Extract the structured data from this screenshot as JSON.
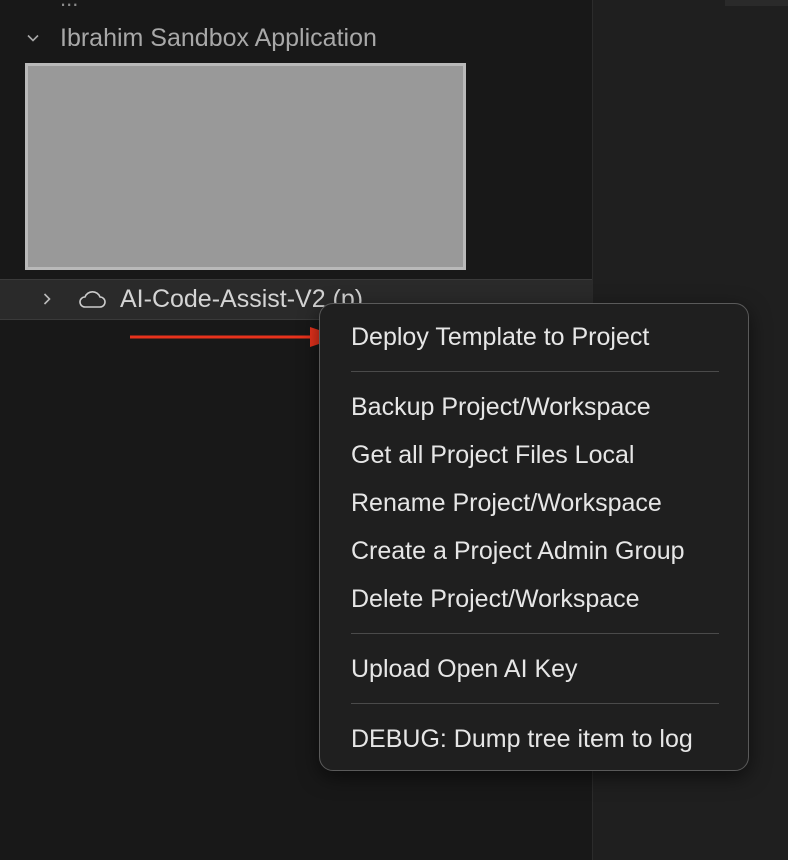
{
  "explorer": {
    "cut_off_text": "...",
    "group": {
      "label": "Ibrahim Sandbox Application",
      "expanded": true
    },
    "project_item": {
      "label": "AI-Code-Assist-V2 (p)",
      "icon": "cloud-icon",
      "expanded": false
    }
  },
  "context_menu": {
    "items": [
      "Deploy Template to Project",
      "Backup Project/Workspace",
      "Get all Project Files Local",
      "Rename Project/Workspace",
      "Create a Project Admin Group",
      "Delete Project/Workspace",
      "Upload Open AI Key",
      "DEBUG: Dump tree item to log"
    ]
  },
  "annotation": {
    "arrow_color": "#e8321c",
    "points_to": "Deploy Template to Project"
  },
  "colors": {
    "sidebar_bg": "#181818",
    "menu_bg": "#1f1f1f",
    "redaction": "#999999"
  }
}
